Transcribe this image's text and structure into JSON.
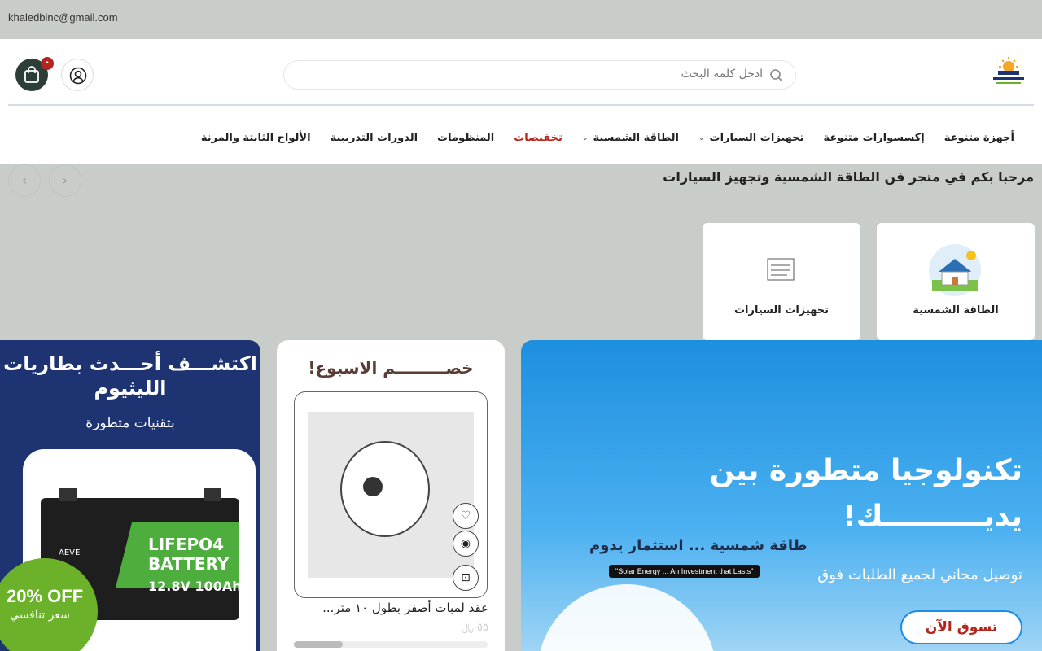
{
  "topbar": {
    "email": "khaledbinc@gmail.com"
  },
  "header": {
    "search_placeholder": "ادخل كلمة البحث",
    "cart_count": "•"
  },
  "nav": [
    {
      "label": "الألواح الثابتة والمرنة",
      "sale": false,
      "chevron": false
    },
    {
      "label": "الدورات التدريبية",
      "sale": false,
      "chevron": false
    },
    {
      "label": "المنظومات",
      "sale": false,
      "chevron": false
    },
    {
      "label": "تخفيضات",
      "sale": true,
      "chevron": false
    },
    {
      "label": "الطاقة الشمسية",
      "sale": false,
      "chevron": true
    },
    {
      "label": "تحهيزات السيارات",
      "sale": false,
      "chevron": true
    },
    {
      "label": "إكسسوارات متنوعة",
      "sale": false,
      "chevron": false
    },
    {
      "label": "أجهزة متنوعة",
      "sale": false,
      "chevron": false
    }
  ],
  "welcome": "مرحبا بكم في متجر فن الطاقة الشمسية وتجهيز السيارات",
  "categories": [
    {
      "label": "الطاقة الشمسية"
    },
    {
      "label": "تحهيزات السيارات"
    }
  ],
  "promo_left": {
    "headline": "اكتشـــف أحـــدث بطاريات الليثيوم",
    "subline": "بتقنيات متطورة",
    "off_percent": "20% OFF",
    "off_label": "سعر تنافسي"
  },
  "weekly": {
    "title": "خصـــــــــم الاسبوع!",
    "product_name": "عقد لمبات أصفر بطول ١٠ متر...",
    "price": "٥٥ ﷼",
    "progress": 0.25
  },
  "hero": {
    "line1": "تكنولوجيا متطورة بين",
    "line2": "يديــــــــــك!",
    "tag_ar": "طاقة شمسية ... استثمار يدوم",
    "tag_en": "\"Solar Energy ... An Investment that Lasts\"",
    "subtitle": "توصيل مجاني لجميع الطلبات فوق",
    "cta": "تسوق الآن"
  },
  "colors": {
    "accent": "#2c3e37",
    "sale": "#b3261e",
    "hero": "#1d8fe0",
    "promo": "#1e3472"
  }
}
